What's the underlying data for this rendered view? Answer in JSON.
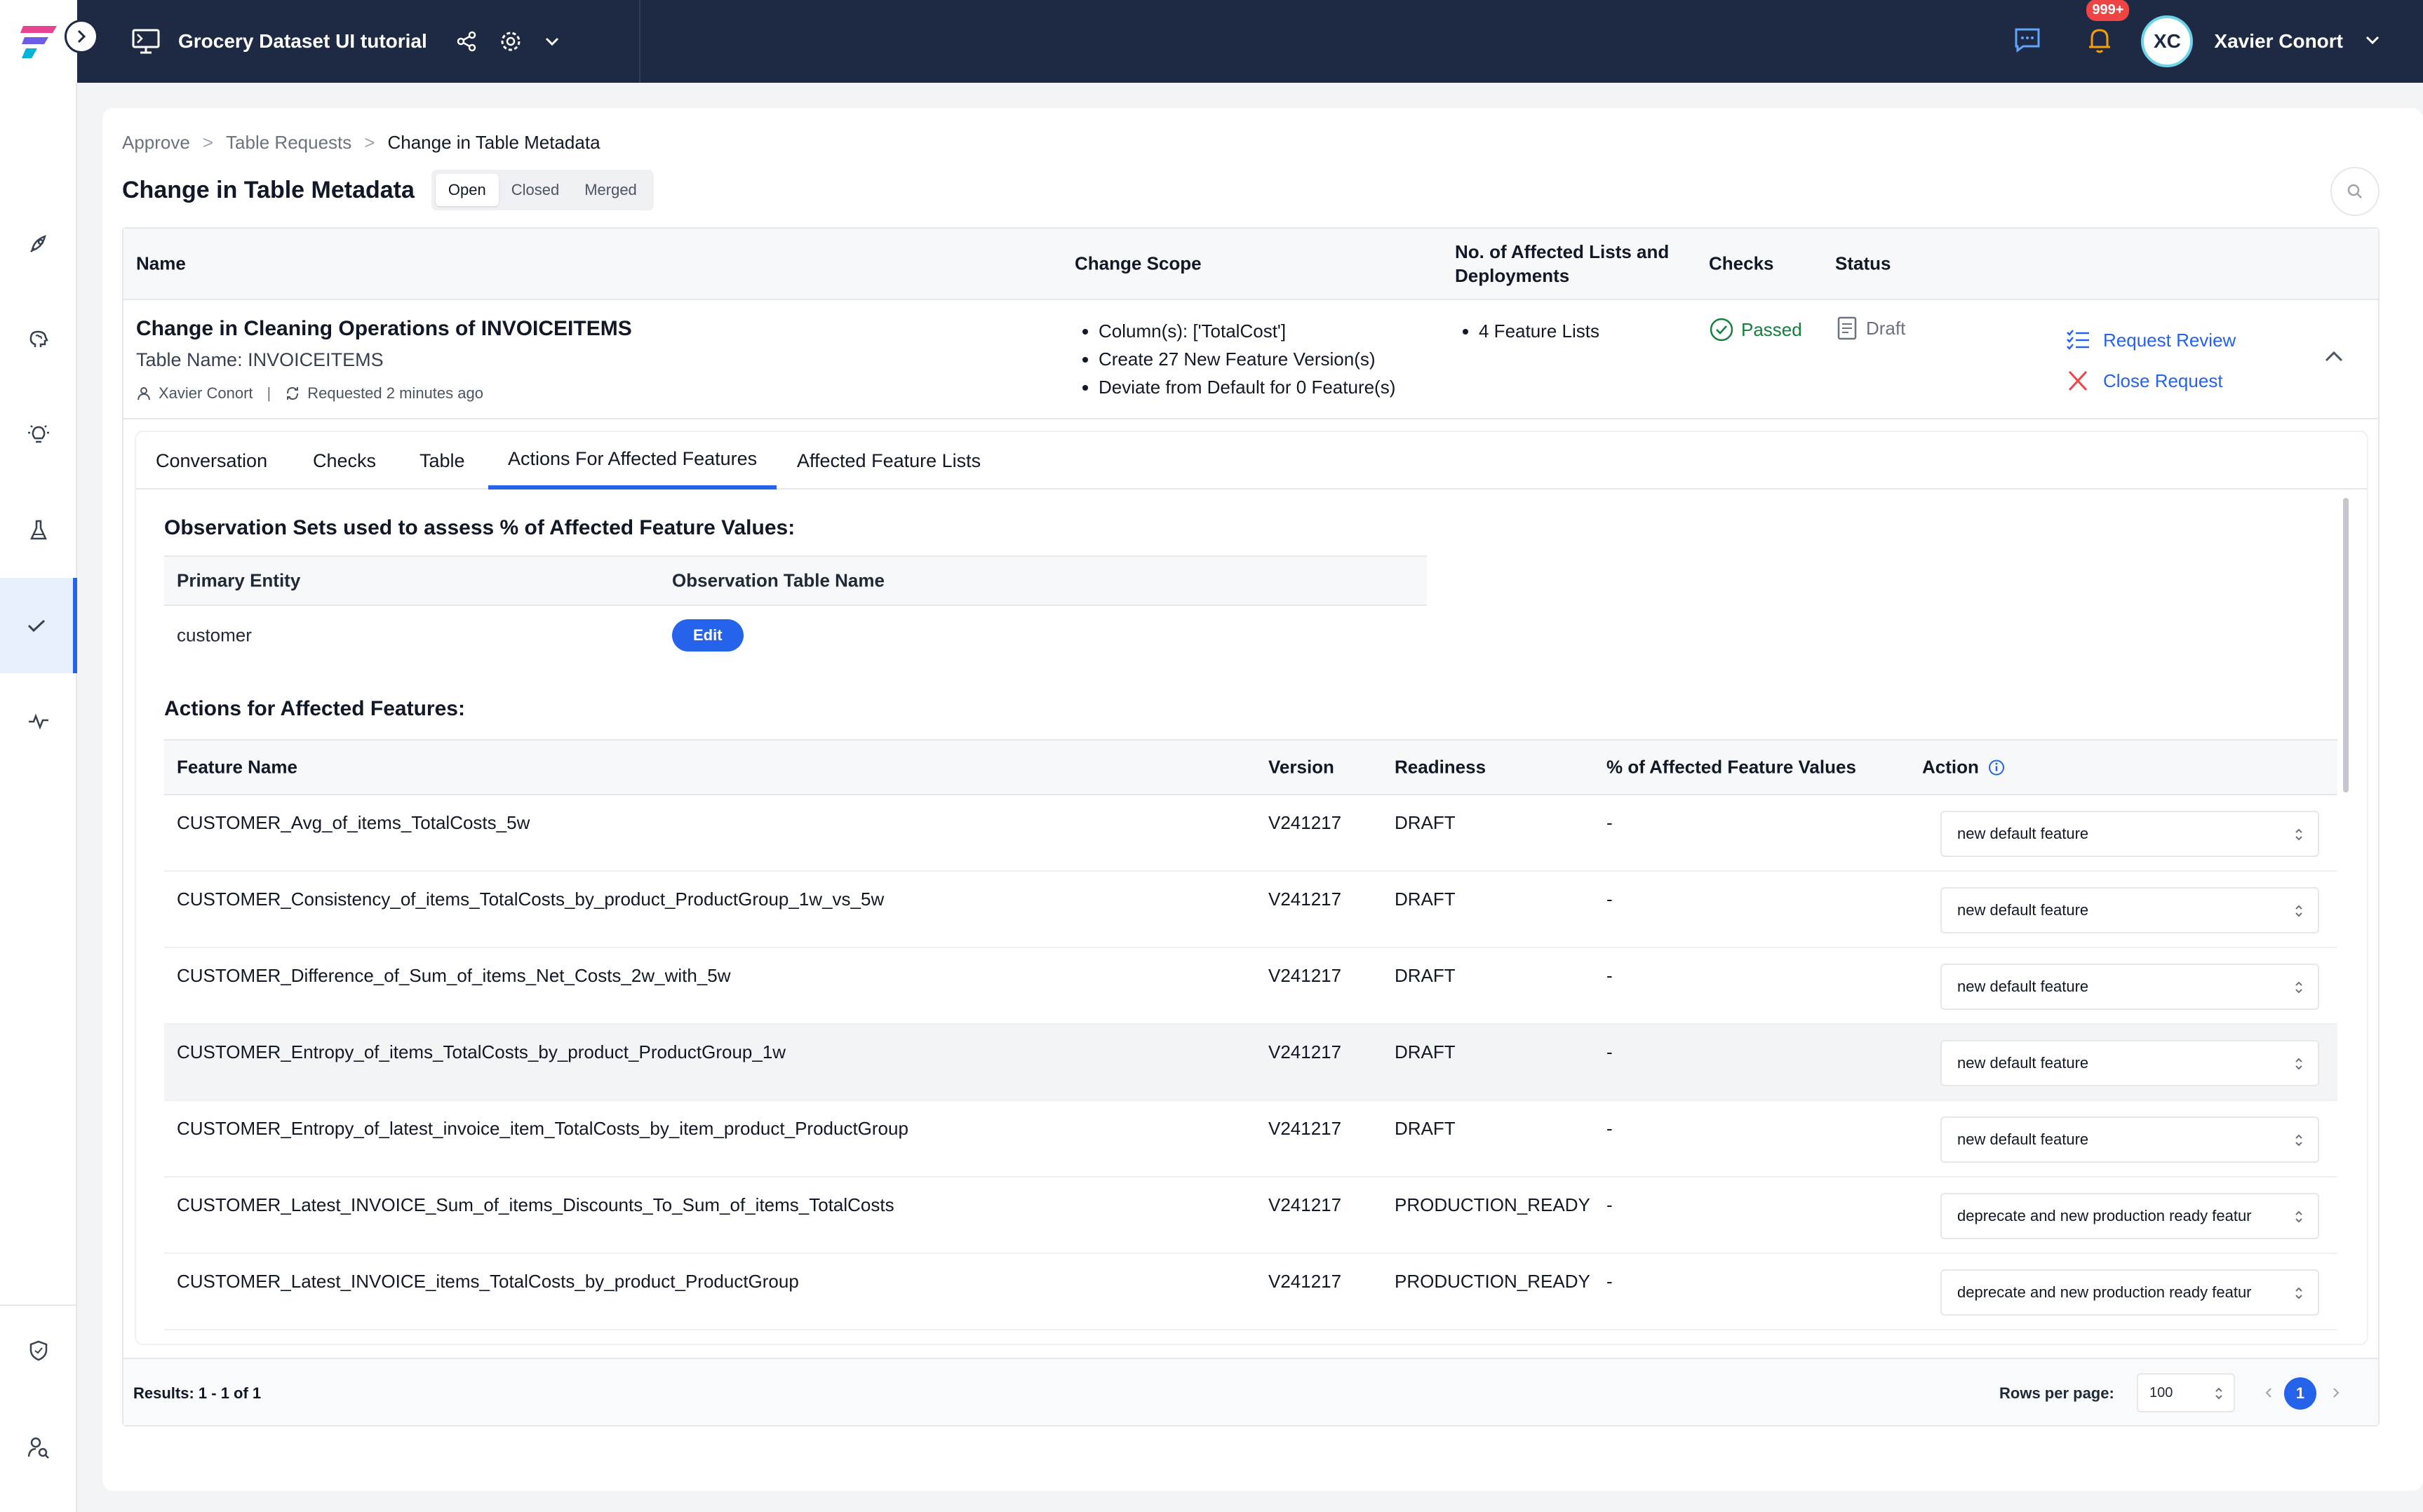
{
  "header": {
    "project_title": "Grocery Dataset UI tutorial",
    "notification_count": "999+",
    "avatar_initials": "XC",
    "user_name": "Xavier Conort"
  },
  "breadcrumb": {
    "items": [
      "Approve",
      "Table Requests",
      "Change in Table Metadata"
    ],
    "separator": ">"
  },
  "page": {
    "title": "Change in Table Metadata",
    "filters": [
      "Open",
      "Closed",
      "Merged"
    ],
    "selected_filter": "Open"
  },
  "request_table": {
    "columns": {
      "name": "Name",
      "scope": "Change Scope",
      "affected": "No. of Affected Lists and Deployments",
      "checks": "Checks",
      "status": "Status"
    },
    "row": {
      "name": "Change in Cleaning Operations of INVOICEITEMS",
      "table_name": "Table Name: INVOICEITEMS",
      "requester": "Xavier Conort",
      "requested": "Requested 2 minutes ago",
      "scope": [
        "Column(s): ['TotalCost']",
        "Create 27 New Feature Version(s)",
        "Deviate from Default for 0 Feature(s)"
      ],
      "affected": [
        "4 Feature Lists"
      ],
      "checks": "Passed",
      "status": "Draft",
      "actions": [
        "Request Review",
        "Close Request"
      ]
    }
  },
  "tabs": {
    "items": [
      "Conversation",
      "Checks",
      "Table",
      "Actions For Affected Features",
      "Affected Feature Lists"
    ],
    "selected": "Actions For Affected Features"
  },
  "observation": {
    "title": "Observation Sets used to assess % of Affected Feature Values:",
    "columns": [
      "Primary Entity",
      "Observation Table Name"
    ],
    "row": {
      "entity": "customer",
      "edit_label": "Edit"
    }
  },
  "features": {
    "title": "Actions for Affected Features:",
    "columns": [
      "Feature Name",
      "Version",
      "Readiness",
      "% of Affected Feature Values",
      "Action"
    ],
    "rows": [
      {
        "name": "CUSTOMER_Avg_of_items_TotalCosts_5w",
        "version": "V241217",
        "readiness": "DRAFT",
        "pct": "-",
        "action": "new default feature"
      },
      {
        "name": "CUSTOMER_Consistency_of_items_TotalCosts_by_product_ProductGroup_1w_vs_5w",
        "version": "V241217",
        "readiness": "DRAFT",
        "pct": "-",
        "action": "new default feature"
      },
      {
        "name": "CUSTOMER_Difference_of_Sum_of_items_Net_Costs_2w_with_5w",
        "version": "V241217",
        "readiness": "DRAFT",
        "pct": "-",
        "action": "new default feature"
      },
      {
        "name": "CUSTOMER_Entropy_of_items_TotalCosts_by_product_ProductGroup_1w",
        "version": "V241217",
        "readiness": "DRAFT",
        "pct": "-",
        "action": "new default feature"
      },
      {
        "name": "CUSTOMER_Entropy_of_latest_invoice_item_TotalCosts_by_item_product_ProductGroup",
        "version": "V241217",
        "readiness": "DRAFT",
        "pct": "-",
        "action": "new default feature"
      },
      {
        "name": "CUSTOMER_Latest_INVOICE_Sum_of_items_Discounts_To_Sum_of_items_TotalCosts",
        "version": "V241217",
        "readiness": "PRODUCTION_READY",
        "pct": "-",
        "action": "deprecate and new production ready featur"
      },
      {
        "name": "CUSTOMER_Latest_INVOICE_items_TotalCosts_by_product_ProductGroup",
        "version": "V241217",
        "readiness": "PRODUCTION_READY",
        "pct": "-",
        "action": "deprecate and new production ready featur"
      }
    ]
  },
  "footer": {
    "results": "Results: 1 - 1 of 1",
    "rows_per_page_label": "Rows per page:",
    "rows_per_page": "100",
    "current_page": "1"
  },
  "colors": {
    "topbar": "#1e2a44",
    "accent": "#2563eb",
    "passed": "#15803d",
    "danger": "#ef4444"
  }
}
